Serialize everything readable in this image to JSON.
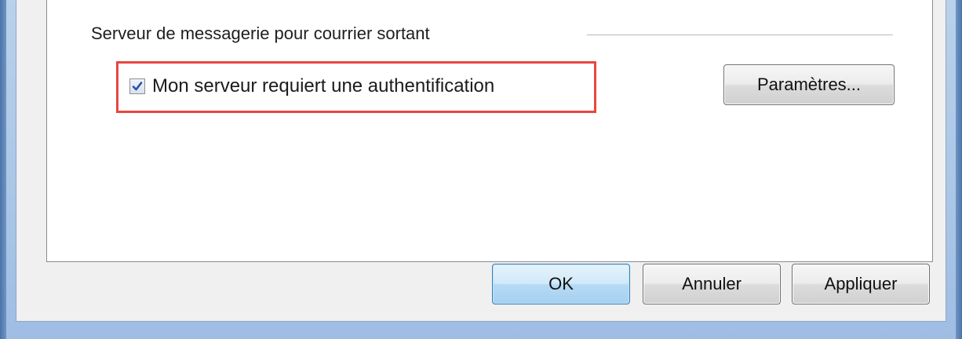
{
  "outgoing_server": {
    "section_title": "Serveur de messagerie pour courrier sortant",
    "auth_required": {
      "label": "Mon serveur requiert une authentification",
      "checked": true
    },
    "settings_button": "Paramètres..."
  },
  "footer": {
    "ok_label": "OK",
    "cancel_label": "Annuler",
    "apply_label": "Appliquer"
  },
  "colors": {
    "highlight_border": "#e8463f",
    "window_frame": "#aac6e6",
    "checkmark": "#2c4fa3"
  },
  "icons": {
    "checkbox": "checkmark-icon"
  }
}
